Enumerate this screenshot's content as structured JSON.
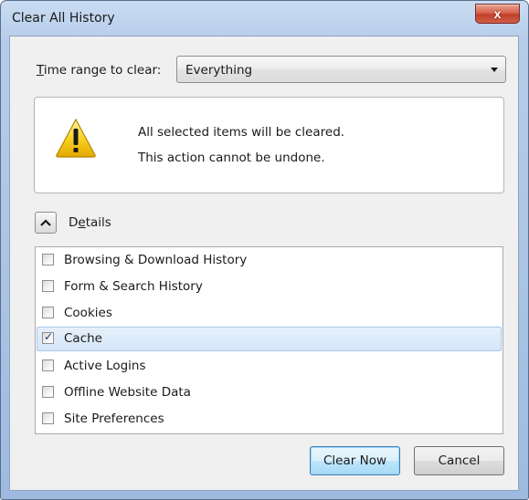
{
  "window": {
    "title": "Clear All History",
    "close_glyph": "x"
  },
  "time_range": {
    "label_prefix": "",
    "label_mnemonic": "T",
    "label_rest": "ime range to clear:",
    "selected": "Everything"
  },
  "warning": {
    "icon": "warning-triangle-icon",
    "line1": "All selected items will be cleared.",
    "line2": "This action cannot be undone."
  },
  "details": {
    "label_first": "D",
    "label_mnemonic": "e",
    "label_rest": "tails",
    "expanded": true
  },
  "items": [
    {
      "label": "Browsing & Download History",
      "checked": false,
      "selected": false
    },
    {
      "label": "Form & Search History",
      "checked": false,
      "selected": false
    },
    {
      "label": "Cookies",
      "checked": false,
      "selected": false
    },
    {
      "label": "Cache",
      "checked": true,
      "selected": true
    },
    {
      "label": "Active Logins",
      "checked": false,
      "selected": false
    },
    {
      "label": "Offline Website Data",
      "checked": false,
      "selected": false
    },
    {
      "label": "Site Preferences",
      "checked": false,
      "selected": false
    }
  ],
  "buttons": {
    "clear_now": "Clear Now",
    "cancel": "Cancel"
  },
  "colors": {
    "accent_selection": "#d6e6f8",
    "warning_yellow": "#f5c400",
    "close_red": "#c1402a"
  }
}
